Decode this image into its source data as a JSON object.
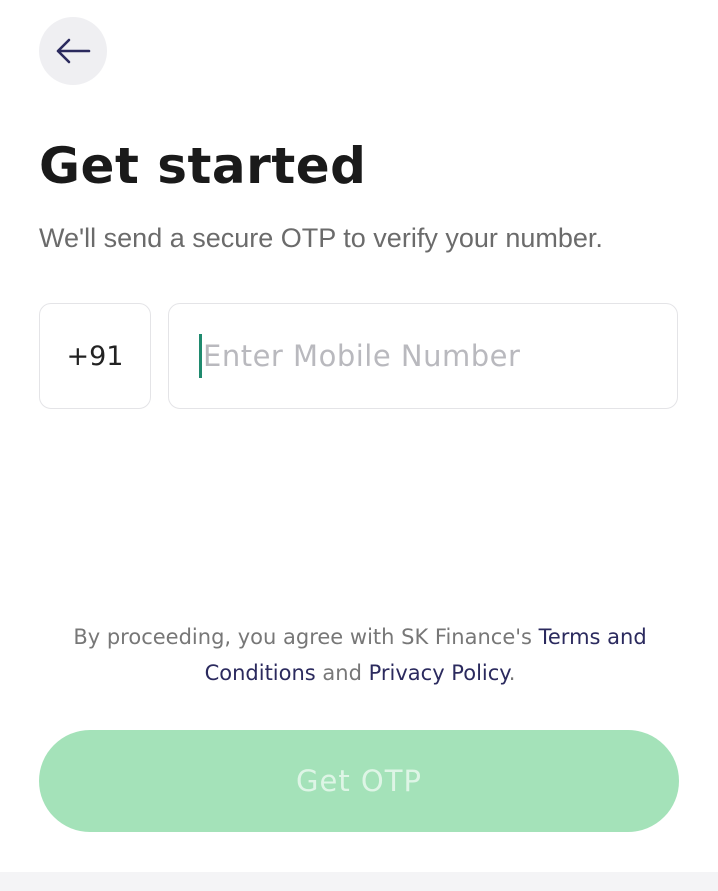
{
  "header": {
    "back_icon": "arrow-left-icon"
  },
  "main": {
    "title": "Get started",
    "subtitle": "We'll send a secure OTP to verify your number.",
    "country_code": "+91",
    "mobile_placeholder": "Enter Mobile Number",
    "mobile_value": ""
  },
  "consent": {
    "prefix": "By proceeding, you agree with SK Finance's ",
    "terms_link": "Terms and Conditions",
    "middle": " and ",
    "privacy_link": "Privacy Policy",
    "suffix": "."
  },
  "actions": {
    "get_otp_label": "Get OTP"
  },
  "colors": {
    "accent": "#2b2a5e",
    "button_disabled": "#a4e2b9",
    "caret": "#1f8a6e"
  }
}
